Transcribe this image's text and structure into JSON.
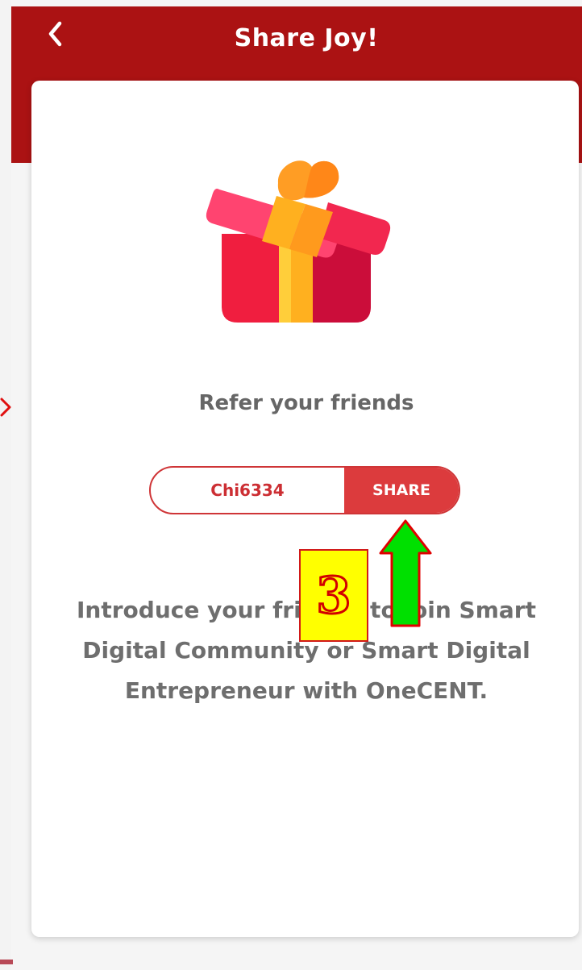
{
  "header": {
    "title": "Share Joy!",
    "back_icon": "chevron-left-icon"
  },
  "card": {
    "gift_icon": "gift-box-icon",
    "refer_title": "Refer your friends",
    "referral_code": "Chi6334",
    "share_label": "SHARE",
    "intro_lines": [
      "Introduce your friends to join Smart",
      "Digital Community or Smart Digital",
      "Entrepreneur with OneCENT."
    ]
  },
  "annotation": {
    "step_number": "3",
    "arrow_icon": "up-arrow-icon"
  },
  "colors": {
    "header": "#ab1213",
    "accent": "#dc3b3d",
    "annotation_yellow": "#ffff00",
    "annotation_green": "#00e000"
  }
}
